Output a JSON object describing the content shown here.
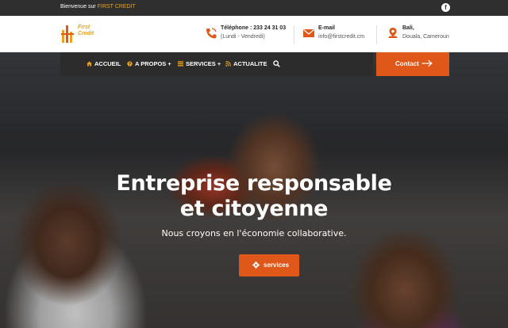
{
  "topbar": {
    "welcome_text": "Bienvenue sur",
    "brand": "FIRST CREDIT",
    "facebook_icon": "f"
  },
  "header": {
    "logo_text": "First\nCredit",
    "phone": {
      "icon": "phone-icon",
      "title": "Téléphone : 233 24 31 03",
      "subtitle": "(Lundi - Vendredi)"
    },
    "email": {
      "icon": "envelope-icon",
      "title": "E-mail",
      "subtitle": "info@firstcredit.cm"
    },
    "address": {
      "icon": "map-marker-icon",
      "title": "Bali,",
      "subtitle": "Douala, Cameroun"
    }
  },
  "nav": {
    "items": [
      {
        "label": "ACCUEIL",
        "icon": "home-icon"
      },
      {
        "label": "A PROPOS +",
        "icon": "question-circle-icon"
      },
      {
        "label": "SERVICES +",
        "icon": "list-icon"
      },
      {
        "label": "ACTUALITE",
        "icon": "rss-icon"
      }
    ],
    "search_icon": "search-icon",
    "contact_label": "Contact"
  },
  "hero": {
    "title_line1": "Entreprise responsable",
    "title_line2": "et citoyenne",
    "subtitle": "Nous croyons en l'économie collaborative.",
    "button_label": "services"
  },
  "colors": {
    "accent": "#e0571a",
    "brand_yellow": "#e8a21b",
    "topbar_bg": "#2f2f2f",
    "nav_bg": "#2c2c2c"
  }
}
